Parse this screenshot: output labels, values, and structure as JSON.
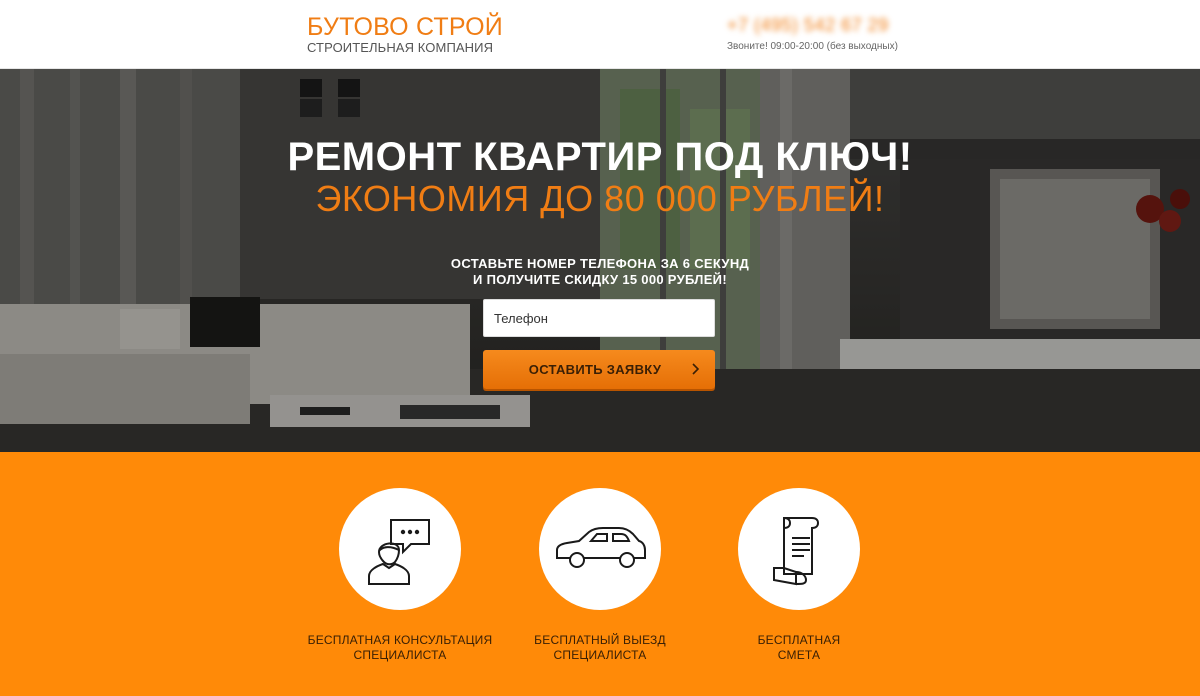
{
  "header": {
    "logo_name": "БУТОВО СТРОЙ",
    "logo_sub": "СТРОИТЕЛЬНАЯ КОМПАНИЯ",
    "phone": "+7 (495) 542 67 29",
    "hours": "Звоните! 09:00-20:00 (без выходных)"
  },
  "hero": {
    "title": "РЕМОНТ КВАРТИР ПОД КЛЮЧ!",
    "subtitle": "ЭКОНОМИЯ ДО 80 000 РУБЛЕЙ!",
    "cta_line1": "ОСТАВЬТЕ НОМЕР ТЕЛЕФОНА ЗА 6 СЕКУНД",
    "cta_line2": "И ПОЛУЧИТЕ СКИДКУ 15 000 РУБЛЕЙ!",
    "phone_placeholder": "Телефон",
    "submit_label": "ОСТАВИТЬ ЗАЯВКУ"
  },
  "features": [
    {
      "icon": "consultant-icon",
      "line1": "БЕСПЛАТНАЯ КОНСУЛЬТАЦИЯ",
      "line2": "СПЕЦИАЛИСТА"
    },
    {
      "icon": "car-icon",
      "line1": "БЕСПЛАТНЫЙ ВЫЕЗД",
      "line2": "СПЕЦИАЛИСТА"
    },
    {
      "icon": "document-scroll-icon",
      "line1": "БЕСПЛАТНАЯ",
      "line2": "СМЕТА"
    }
  ],
  "colors": {
    "accent": "#f07d14",
    "features_bg": "#ff8a08",
    "hero_dark": "#3a3936"
  }
}
